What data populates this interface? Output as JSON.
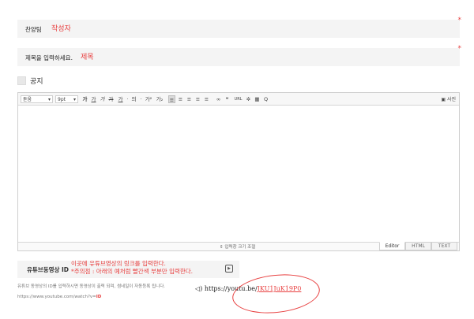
{
  "author_field": {
    "label": "찬양팀",
    "value": "작성자",
    "required_mark": "*"
  },
  "title_field": {
    "label": "제목을 입력하세요.",
    "value": "제목",
    "required_mark": "*"
  },
  "notice": {
    "label": "공지",
    "checked": false
  },
  "toolbar": {
    "font_select": "돋움",
    "size_select": "9pt",
    "buttons": [
      "가",
      "가",
      "가",
      "가",
      "가",
      "·",
      "의",
      "·",
      "가²",
      "가₂",
      "≡",
      "≡",
      "≡",
      "≡",
      "≡",
      "∞",
      "❝",
      "URL",
      "✲",
      "▦",
      "Q"
    ],
    "photo_label": "사진"
  },
  "editor_footer": {
    "resize_label": "⇕ 입력창 크기 조절",
    "modes": [
      "Editor",
      "HTML",
      "TEXT"
    ],
    "active_mode": "Editor"
  },
  "youtube": {
    "label": "유튜브동영상 ID",
    "note_line1": "이곳에 유튜브영상의 링크를 입력한다.",
    "note_line2": "*주의점 : 아래의 예처럼 빨간색 부분만 입력한다.",
    "help_text": "유튜브 동영상의 ID를 입력하시면 동영상이 출력 되며, 썸네일이 자동등록 됩니다.",
    "help_url_prefix": "https://www.youtube.com/watch?v=",
    "help_url_id": "ID",
    "example_prefix": "https://youtu.be/",
    "example_id": "JKU1JuK19P0",
    "example_icon": "◁)"
  },
  "colors": {
    "accent_red": "#e84040",
    "field_bg": "#f4f4f4"
  }
}
